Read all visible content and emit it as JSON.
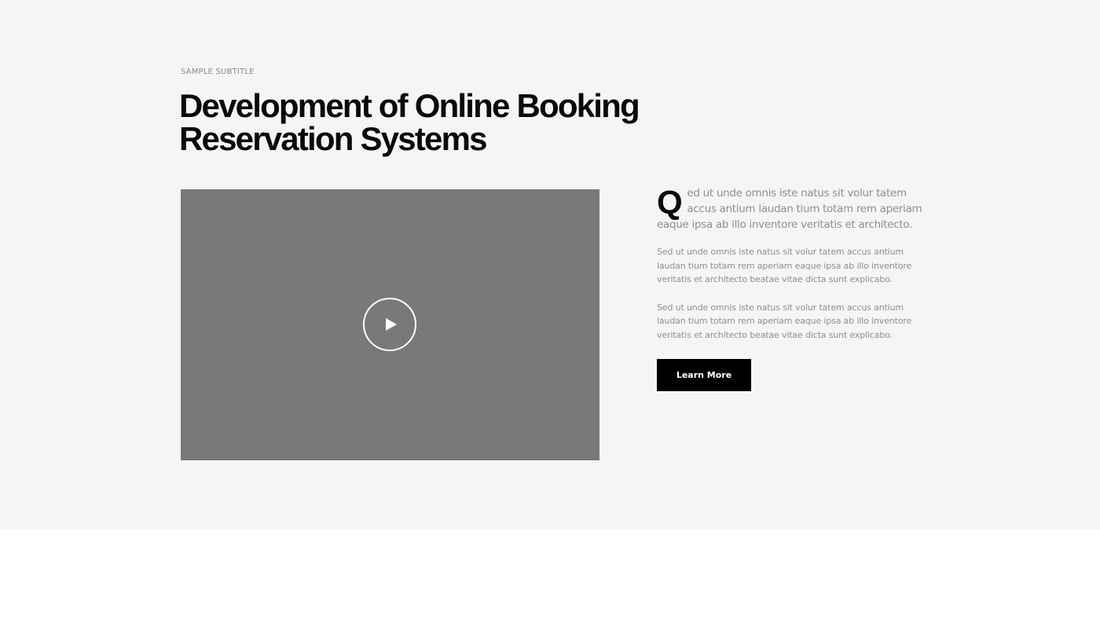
{
  "header": {
    "subtitle": "SAMPLE SUBTITLE",
    "title": "Development of Online Booking Reservation Systems"
  },
  "video": {
    "play_icon": "play-icon",
    "background_color": "#79797b"
  },
  "content": {
    "lead_drop_cap": "Q",
    "lead_text": "ed ut unde omnis iste natus sit volur tatem accus antium laudan tium totam rem aperiam eaque ipsa ab illo inventore veritatis et architecto.",
    "paragraphs": [
      "Sed ut unde omnis iste natus sit volur tatem accus antium laudan tium totam rem aperiam eaque ipsa ab illo inventore veritatis et architecto beatae vitae dicta sunt explicabo.",
      "Sed ut unde omnis iste natus sit volur tatem accus antium laudan tium totam rem aperiam eaque ipsa ab illo inventore veritatis et architecto beatae vitae dicta sunt explicabo."
    ],
    "button_label": "Learn More"
  },
  "colors": {
    "section_bg": "#f5f5f5",
    "button_bg": "#000000",
    "text_muted": "#8e8e8e"
  }
}
